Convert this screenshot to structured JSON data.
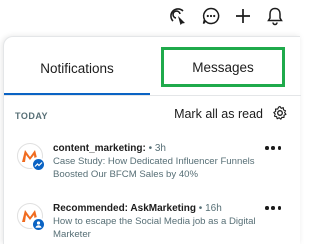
{
  "tabs": {
    "notifications": "Notifications",
    "messages": "Messages"
  },
  "section": {
    "label": "TODAY",
    "mark_all_read": "Mark all as read"
  },
  "notifications": [
    {
      "author": "content_marketing:",
      "time": "3h",
      "body": "Case Study: How Dedicated Influencer Funnels Boosted Our BFCM Sales by 40%",
      "badge_icon": "trending-icon"
    },
    {
      "author": "Recommended: AskMarketing",
      "time": "16h",
      "body": "How to escape the Social Media job as a Digital Marketer",
      "badge_icon": "community-icon"
    }
  ],
  "colors": {
    "accent_blue": "#0a63c4",
    "highlight_green": "#1faa4b",
    "brand_orange": "#f06b1f"
  }
}
